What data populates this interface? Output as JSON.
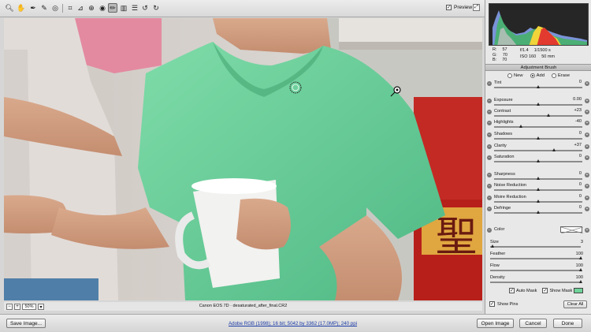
{
  "toolbar": {
    "preview_label": "Preview",
    "preview_checked": "✓",
    "tool_icons": [
      "zoom",
      "hand",
      "white-balance",
      "color-sampler",
      "target-adjustment",
      "crop",
      "straighten",
      "spot-removal",
      "red-eye",
      "adjustment-brush",
      "graduated-filter",
      "preferences",
      "rotate-ccw",
      "rotate-cw"
    ]
  },
  "canvas": {
    "zoom_minus": "−",
    "zoom_plus": "+",
    "zoom_value": "50%",
    "zoom_dropdown": "▾",
    "caption": "Canon EOS 7D  ·  desaturated_after_final.CR2"
  },
  "panel": {
    "readout": {
      "R": "57",
      "G": "70",
      "B": "70",
      "aperture": "f/1.4",
      "shutter": "1/1500 s",
      "iso": "ISO 160",
      "focal": "50 mm",
      "r_label": "R:",
      "g_label": "G:",
      "b_label": "B:"
    },
    "title": "Adjustment Brush",
    "modes": [
      {
        "label": "New",
        "on": false
      },
      {
        "label": "Add",
        "on": true
      },
      {
        "label": "Erase",
        "on": false
      }
    ],
    "sliders": [
      {
        "label": "Tint",
        "value": "0",
        "pos": 0.5
      },
      {
        "label": "Exposure",
        "value": "0.00",
        "pos": 0.5
      },
      {
        "label": "Contrast",
        "value": "+23",
        "pos": 0.62
      },
      {
        "label": "Highlights",
        "value": "-40",
        "pos": 0.3
      },
      {
        "label": "Shadows",
        "value": "0",
        "pos": 0.5
      },
      {
        "label": "Clarity",
        "value": "+37",
        "pos": 0.68
      },
      {
        "label": "Saturation",
        "value": "0",
        "pos": 0.5
      },
      {
        "label": "Sharpness",
        "value": "0",
        "pos": 0.5
      },
      {
        "label": "Noise Reduction",
        "value": "0",
        "pos": 0.5
      },
      {
        "label": "Moire Reduction",
        "value": "0",
        "pos": 0.5
      },
      {
        "label": "Defringe",
        "value": "0",
        "pos": 0.5
      }
    ],
    "color_label": "Color",
    "brush": [
      {
        "label": "Size",
        "value": "3",
        "pos": 0.03
      },
      {
        "label": "Feather",
        "value": "100",
        "pos": 1.0
      },
      {
        "label": "Flow",
        "value": "100",
        "pos": 1.0
      },
      {
        "label": "Density",
        "value": "100",
        "pos": 1.0
      }
    ],
    "auto_mask": "Auto Mask",
    "show_mask": "Show Mask",
    "show_pins": "Show Pins",
    "clear_all": "Clear All",
    "check": "✓",
    "mask_color": "#6fd39a"
  },
  "bottom": {
    "save_image": "Save Image...",
    "workflow": "Adobe RGB (1998); 16 bit; 5042 by 3362 (17.0MP); 240 ppi",
    "open_image": "Open Image",
    "cancel": "Cancel",
    "done": "Done"
  }
}
